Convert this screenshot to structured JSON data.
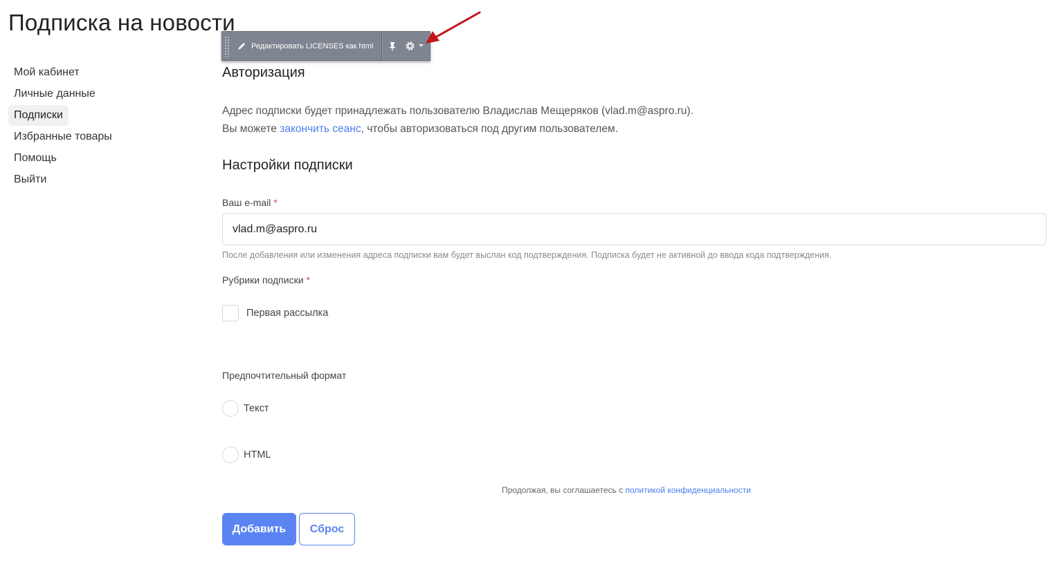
{
  "page": {
    "title": "Подписка на новости"
  },
  "sidebar": {
    "items": [
      {
        "label": "Мой кабинет"
      },
      {
        "label": "Личные данные"
      },
      {
        "label": "Подписки"
      },
      {
        "label": "Избранные товары"
      },
      {
        "label": "Помощь"
      },
      {
        "label": "Выйти"
      }
    ],
    "active_index": 2
  },
  "editbar": {
    "edit_label": "Редактировать LICENSES как html",
    "icons": [
      "pencil-icon",
      "pin-icon",
      "gear-icon",
      "dropdown-caret-icon"
    ]
  },
  "auth": {
    "title": "Авторизация",
    "line1": "Адрес подписки будет принадлежать пользователю Владислав Мещеряков (vlad.m@aspro.ru).",
    "line2_prefix": "Вы можете ",
    "line2_link": "закончить сеанс",
    "line2_suffix": ", чтобы авторизоваться под другим пользователем."
  },
  "settings": {
    "title": "Настройки подписки",
    "email_label": "Ваш e-mail",
    "required_mark": "*",
    "email_value": "vlad.m@aspro.ru",
    "email_hint": "После добавления или изменения адреса подписки вам будет выслан код подтверждения. Подписка будет не активной до ввода кода подтверждения.",
    "rubrics_label": "Рубрики подписки",
    "rubrics": [
      {
        "label": "Первая рассылка",
        "checked": false
      }
    ],
    "format_label": "Предпочтительный формат",
    "formats": [
      {
        "label": "Текст",
        "selected": false
      },
      {
        "label": "HTML",
        "selected": false
      }
    ]
  },
  "policy": {
    "prefix": "Продолжая, вы соглашаетесь с ",
    "link": "политикой конфиденциальности"
  },
  "actions": {
    "add_label": "Добавить",
    "reset_label": "Сброс"
  },
  "colors": {
    "accent": "#5a84f2",
    "link": "#4a7df0",
    "required": "#e04040",
    "editbar": "#7e8590",
    "annotation_arrow": "#c0161c"
  }
}
